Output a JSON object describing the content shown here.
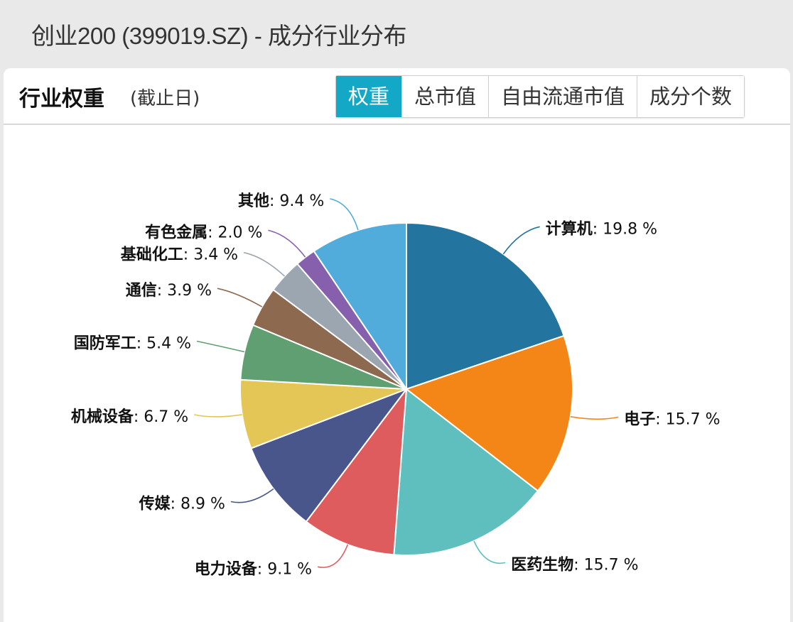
{
  "page": {
    "title": "创业200 (399019.SZ) - 成分行业分布"
  },
  "panel": {
    "title": "行业权重",
    "subtitle": "(截止日)",
    "tabs": [
      {
        "label": "权重",
        "active": true
      },
      {
        "label": "总市值",
        "active": false
      },
      {
        "label": "自由流通市值",
        "active": false
      },
      {
        "label": "成分个数",
        "active": false
      }
    ]
  },
  "chart_data": {
    "type": "pie",
    "title": "行业权重",
    "unit": "%",
    "start": "top",
    "direction": "clockwise",
    "slices": [
      {
        "label": "计算机",
        "value": 19.8,
        "color": "#23749f"
      },
      {
        "label": "电子",
        "value": 15.7,
        "color": "#f48618"
      },
      {
        "label": "医药生物",
        "value": 15.7,
        "color": "#5fbfbf"
      },
      {
        "label": "电力设备",
        "value": 9.1,
        "color": "#df5c5e"
      },
      {
        "label": "传媒",
        "value": 8.9,
        "color": "#48568c"
      },
      {
        "label": "机械设备",
        "value": 6.7,
        "color": "#e3c656"
      },
      {
        "label": "国防军工",
        "value": 5.4,
        "color": "#5f9f72"
      },
      {
        "label": "通信",
        "value": 3.9,
        "color": "#8d6a4f"
      },
      {
        "label": "基础化工",
        "value": 3.4,
        "color": "#9ba6b0"
      },
      {
        "label": "有色金属",
        "value": 2.0,
        "color": "#8660ad"
      },
      {
        "label": "其他",
        "value": 9.4,
        "color": "#52acdb"
      }
    ]
  }
}
